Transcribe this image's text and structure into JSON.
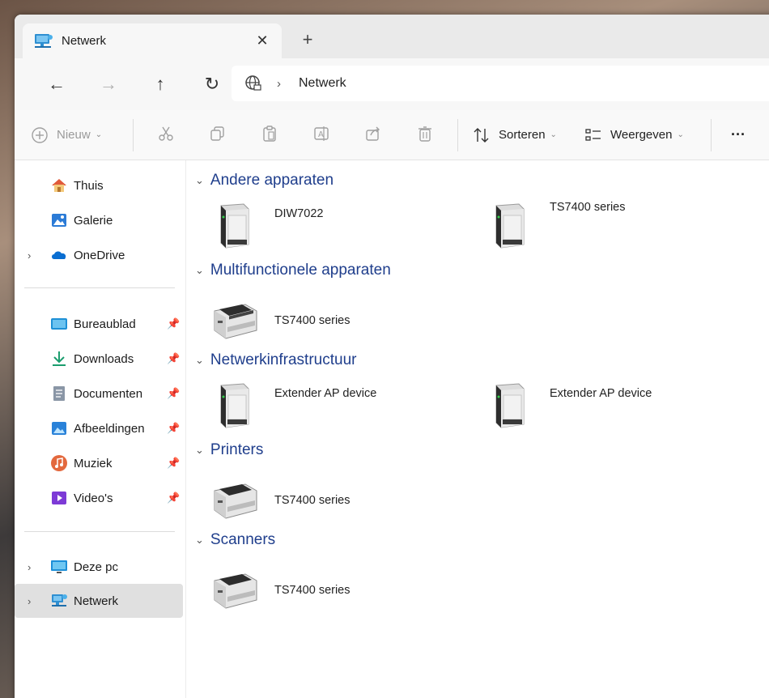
{
  "window": {
    "tab_title": "Netwerk",
    "tab_close": "✕",
    "new_tab": "+"
  },
  "nav": {
    "back": "←",
    "forward": "→",
    "up": "↑",
    "refresh": "↻",
    "address_chevron": "›",
    "address_text": "Netwerk"
  },
  "toolbar": {
    "new_label": "Nieuw",
    "sort_label": "Sorteren",
    "view_label": "Weergeven",
    "more": "···",
    "icons": [
      "cut-icon",
      "copy-icon",
      "paste-icon",
      "rename-icon",
      "share-icon",
      "delete-icon"
    ]
  },
  "sidebar": {
    "items": [
      {
        "label": "Thuis",
        "icon": "home-icon"
      },
      {
        "label": "Galerie",
        "icon": "gallery-icon"
      },
      {
        "label": "OneDrive",
        "icon": "cloud-icon"
      }
    ],
    "quick": [
      {
        "label": "Bureaublad",
        "icon": "desktop-icon"
      },
      {
        "label": "Downloads",
        "icon": "download-icon"
      },
      {
        "label": "Documenten",
        "icon": "document-icon"
      },
      {
        "label": "Afbeeldingen",
        "icon": "pictures-icon"
      },
      {
        "label": "Muziek",
        "icon": "music-icon"
      },
      {
        "label": "Video's",
        "icon": "video-icon"
      }
    ],
    "bottom": [
      {
        "label": "Deze pc",
        "icon": "monitor-icon"
      },
      {
        "label": "Netwerk",
        "icon": "network-icon"
      }
    ]
  },
  "groups": [
    {
      "title": "Andere apparaten",
      "devices": [
        {
          "label": "DIW7022",
          "kind": "tower"
        },
        {
          "label": "TS7400 series",
          "kind": "tower"
        }
      ]
    },
    {
      "title": "Multifunctionele apparaten",
      "devices": [
        {
          "label": "TS7400 series",
          "kind": "printer"
        }
      ]
    },
    {
      "title": "Netwerkinfrastructuur",
      "devices": [
        {
          "label": "Extender AP device",
          "kind": "tower"
        },
        {
          "label": "Extender AP device",
          "kind": "tower"
        }
      ]
    },
    {
      "title": "Printers",
      "devices": [
        {
          "label": "TS7400 series",
          "kind": "printer"
        }
      ]
    },
    {
      "title": "Scanners",
      "devices": [
        {
          "label": "TS7400 series",
          "kind": "printer"
        }
      ]
    }
  ],
  "colors": {
    "group_header": "#1f3e8c",
    "selected_bg": "#e0e0e0"
  }
}
